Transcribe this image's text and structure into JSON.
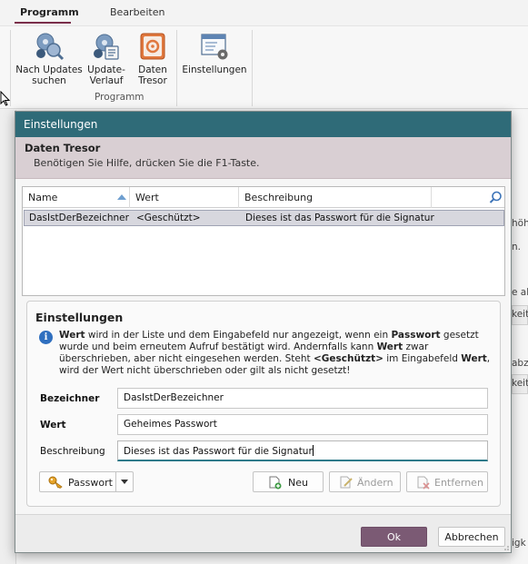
{
  "ribbon": {
    "tabs": [
      {
        "label": "Programm",
        "active": true
      },
      {
        "label": "Bearbeiten",
        "active": false
      }
    ],
    "buttons": [
      {
        "label_line1": "Nach Updates",
        "label_line2": "suchen",
        "icon": "search-updates-icon"
      },
      {
        "label_line1": "Update-",
        "label_line2": "Verlauf",
        "icon": "update-history-icon"
      },
      {
        "label_line1": "Daten",
        "label_line2": "Tresor",
        "icon": "safe-icon"
      },
      {
        "label_line1": "Einstellungen",
        "label_line2": "",
        "icon": "settings-window-icon"
      }
    ],
    "group_label": "Programm"
  },
  "background": {
    "fragments": [
      "höh",
      "n.",
      "e ab",
      "keit",
      "abz",
      "keit",
      "igk"
    ]
  },
  "dialog": {
    "title": "Einstellungen",
    "header": {
      "title": "Daten Tresor",
      "subtitle": "Benötigen Sie Hilfe, drücken Sie die F1-Taste."
    },
    "grid": {
      "columns": [
        "Name",
        "Wert",
        "Beschreibung"
      ],
      "rows": [
        {
          "name": "DasIstDerBezeichner",
          "wert": "<Geschützt>",
          "beschreibung": "Dieses ist das Passwort für die Signatur",
          "selected": true
        }
      ]
    },
    "settings": {
      "title": "Einstellungen",
      "info": {
        "p1": "Wert",
        "p2": " wird in der Liste und dem Eingabefeld nur angezeigt, wenn ein ",
        "p3": "Passwort",
        "p4": " gesetzt wurde und beim erneutem Aufruf bestätigt wird. Andernfalls kann ",
        "p5": "Wert",
        "p6": " zwar überschrieben, aber nicht eingesehen werden. Steht ",
        "p7": "<Geschützt>",
        "p8": " im Eingabefeld ",
        "p9": "Wert",
        "p10": ", wird der Wert nicht überschrieben oder gilt als nicht gesetzt!"
      },
      "fields": {
        "bezeichner_label": "Bezeichner",
        "bezeichner_value": "DasIstDerBezeichner",
        "wert_label": "Wert",
        "wert_value": "Geheimes Passwort",
        "beschreibung_label": "Beschreibung",
        "beschreibung_value": "Dieses ist das Passwort für die Signatur"
      },
      "buttons": {
        "passwort": "Passwort",
        "neu": "Neu",
        "aendern": "Ändern",
        "entfernen": "Entfernen"
      }
    },
    "footer": {
      "ok": "Ok",
      "cancel": "Abbrechen"
    }
  },
  "colors": {
    "title_bar": "#2f6b78",
    "header_band": "#d9cfd3",
    "ok_button": "#7b5a74",
    "active_tab_underline": "#7a2e4a"
  }
}
